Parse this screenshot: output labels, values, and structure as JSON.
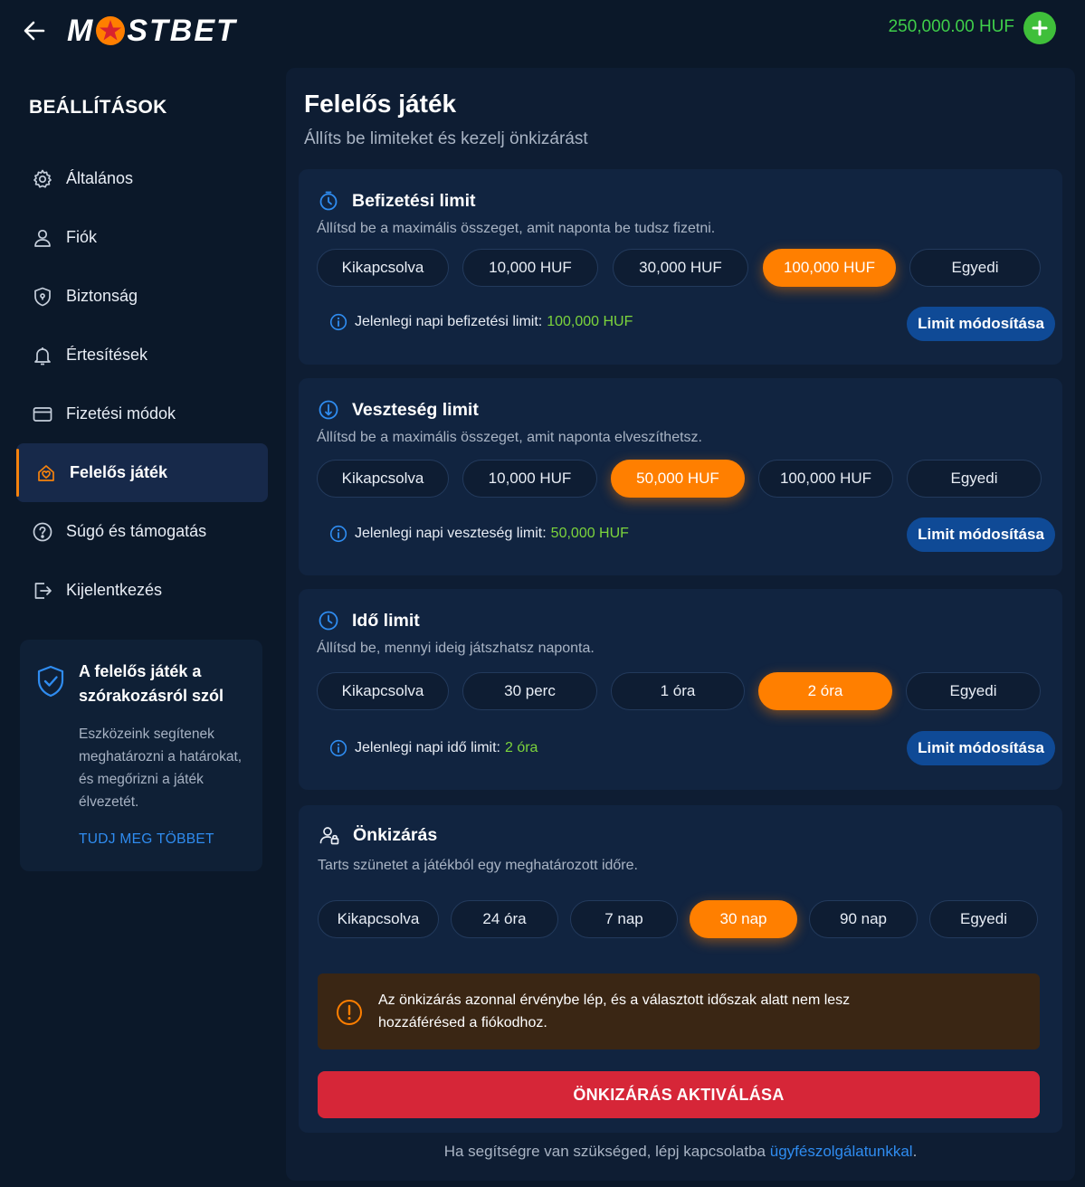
{
  "header": {
    "logo_left": "M",
    "logo_right": "STBET",
    "balance": "250,000.00 HUF"
  },
  "sidebar": {
    "title": "BEÁLLÍTÁSOK",
    "items": [
      {
        "label": "Általános",
        "icon": "gear-icon"
      },
      {
        "label": "Fiók",
        "icon": "user-icon"
      },
      {
        "label": "Biztonság",
        "icon": "shield-icon"
      },
      {
        "label": "Értesítések",
        "icon": "bell-icon"
      },
      {
        "label": "Fizetési módok",
        "icon": "card-icon"
      },
      {
        "label": "Felelős játék",
        "icon": "responsible-gaming-icon",
        "active": true
      },
      {
        "label": "Súgó és támogatás",
        "icon": "help-icon"
      },
      {
        "label": "Kijelentkezés",
        "icon": "logout-icon"
      }
    ],
    "promo": {
      "title": "A felelős játék a szórakozásról szól",
      "text": "Eszközeink segítenek meghatározni a határokat, és megőrizni a játék élvezetét.",
      "link": "TUDJ MEG TÖBBET"
    }
  },
  "main": {
    "title": "Felelős játék",
    "subtitle": "Állíts be limiteket és kezelj önkizárást",
    "deposit": {
      "title": "Befizetési limit",
      "description": "Állítsd be a maximális összeget, amit naponta be tudsz fizetni.",
      "options": [
        "Kikapcsolva",
        "10,000 HUF",
        "30,000 HUF",
        "100,000 HUF",
        "Egyedi"
      ],
      "selected": 3,
      "current_label": "Jelenlegi napi befizetési limit:",
      "current_value": "100,000 HUF",
      "button": "Limit módosítása"
    },
    "loss": {
      "title": "Veszteség limit",
      "description": "Állítsd be a maximális összeget, amit naponta elveszíthetsz.",
      "options": [
        "Kikapcsolva",
        "10,000 HUF",
        "50,000 HUF",
        "100,000 HUF",
        "Egyedi"
      ],
      "selected": 2,
      "current_label": "Jelenlegi napi veszteség limit:",
      "current_value": "50,000 HUF",
      "button": "Limit módosítása"
    },
    "time": {
      "title": "Idő limit",
      "description": "Állítsd be, mennyi ideig játszhatsz naponta.",
      "options": [
        "Kikapcsolva",
        "30 perc",
        "1 óra",
        "2 óra",
        "Egyedi"
      ],
      "selected": 3,
      "current_label": "Jelenlegi napi idő limit:",
      "current_value": "2 óra",
      "button": "Limit módosítása"
    },
    "exclusion": {
      "title": "Önkizárás",
      "description": "Tarts szünetet a játékból egy meghatározott időre.",
      "options": [
        "Kikapcsolva",
        "24 óra",
        "7 nap",
        "30 nap",
        "90 nap",
        "Egyedi"
      ],
      "selected": 3,
      "warning": "Az önkizárás azonnal érvénybe lép, és a választott időszak alatt nem lesz hozzáférésed a fiókodhoz.",
      "button": "ÖNKIZÁRÁS AKTIVÁLÁSA"
    },
    "footer_text": "Ha segítségre van szükséged, lépj kapcsolatba",
    "footer_link": "ügyfészolgálatunkkal",
    "footer_end": "."
  },
  "colors": {
    "accent": "#ff7f00",
    "balance": "#3fcf4a",
    "value": "#7cd43c",
    "link": "#2f8cf0",
    "danger": "#d62638",
    "button_blue": "#0f4a96"
  }
}
